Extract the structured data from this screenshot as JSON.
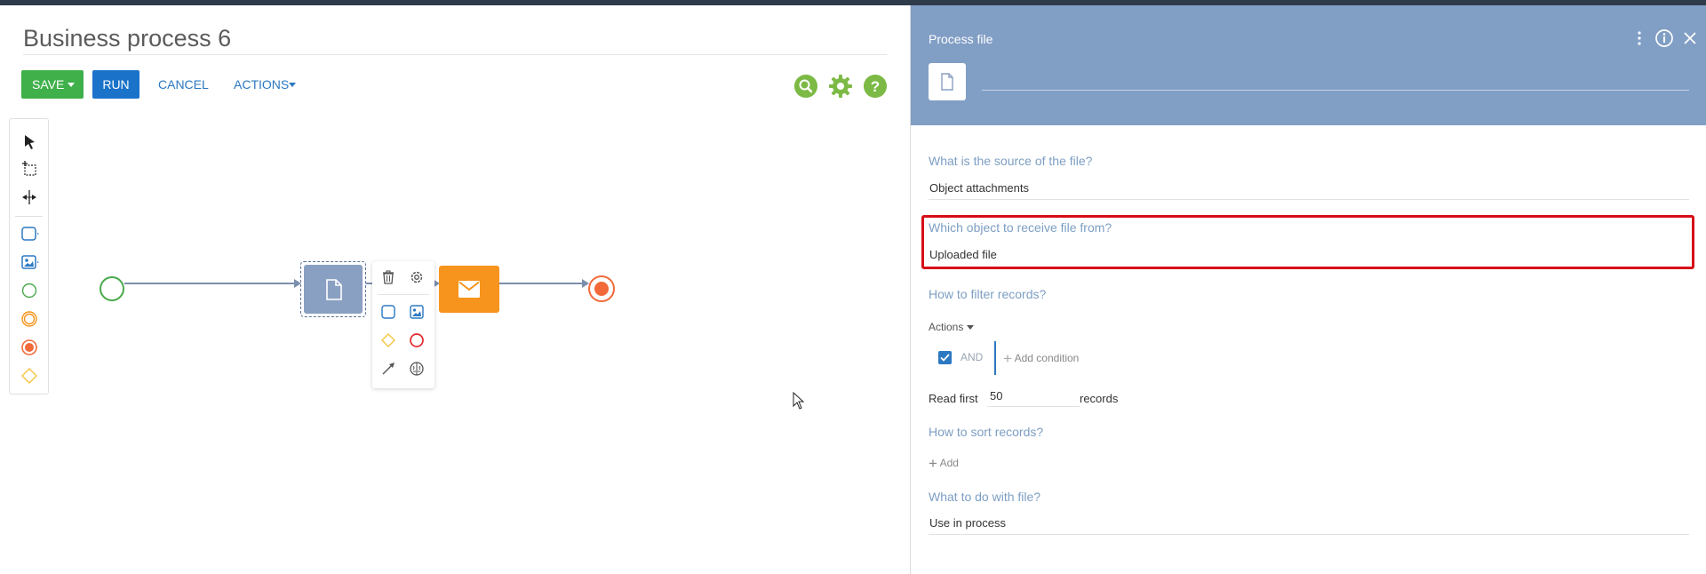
{
  "designer": {
    "title": "Business process 6",
    "toolbar": {
      "save_label": "SAVE",
      "run_label": "RUN",
      "cancel_label": "CANCEL",
      "actions_label": "ACTIONS"
    },
    "tool_icons": [
      "search-icon",
      "gear-icon",
      "help-icon"
    ],
    "palette_icons": [
      "pointer-icon",
      "lasso-icon",
      "space-tool-icon",
      "task-icon",
      "subprocess-icon",
      "start-event-icon",
      "intermediate-event-icon",
      "end-event-icon",
      "gateway-icon"
    ],
    "context_menu_icons": [
      "trash-icon",
      "gear-icon",
      "task-icon",
      "subprocess-icon",
      "gateway-icon",
      "end-event-icon",
      "connector-icon",
      "brain-icon"
    ]
  },
  "panel": {
    "title": "Process file",
    "name_value": "",
    "q_source": "What is the source of the file?",
    "source_value": "Object attachments",
    "q_object": "Which object to receive file from?",
    "object_value": "Uploaded file",
    "q_filter": "How to filter records?",
    "actions_label": "Actions",
    "and_label": "AND",
    "add_condition_label": "Add condition",
    "read_first_label": "Read first",
    "read_first_value": "50",
    "records_label": "records",
    "q_sort": "How to sort records?",
    "add_label": "Add",
    "q_action": "What to do with file?",
    "action_value": "Use in process"
  },
  "colors": {
    "save": "#3fb04a",
    "run": "#1a73c9",
    "panel_header": "#819ec5",
    "label": "#7c9ec3",
    "highlight": "#d60d17",
    "task_file": "#8aa0c2",
    "task_mail": "#f7941d"
  }
}
